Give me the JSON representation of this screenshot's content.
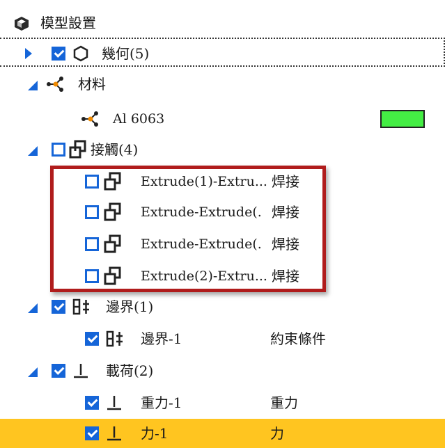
{
  "header": {
    "title": "模型設置",
    "icon": "model-cube-icon"
  },
  "rows": {
    "geometry": {
      "label": "幾何(5)",
      "checked": true,
      "icon": "hexagon-icon"
    },
    "material": {
      "label": "材料",
      "icon": "material-icon"
    },
    "material_item": {
      "label": "Al 6063",
      "color": "#44ee44",
      "icon": "material-icon"
    },
    "contacts": {
      "label": "接觸(4)",
      "checked": false,
      "icon": "contact-icon"
    },
    "contact_1": {
      "label": "Extrude(1)-Extru...",
      "type": "焊接",
      "checked": false
    },
    "contact_2": {
      "label": "Extrude-Extrude(.",
      "type": "焊接",
      "checked": false
    },
    "contact_3": {
      "label": "Extrude-Extrude(.",
      "type": "焊接",
      "checked": false
    },
    "contact_4": {
      "label": "Extrude(2)-Extru...",
      "type": "焊接",
      "checked": false
    },
    "boundary": {
      "label": "邊界(1)",
      "checked": true,
      "icon": "boundary-icon"
    },
    "boundary_1": {
      "label": "邊界-1",
      "type": "約束條件",
      "checked": true
    },
    "loads": {
      "label": "載荷(2)",
      "checked": true,
      "icon": "load-icon"
    },
    "load_1": {
      "label": "重力-1",
      "type": "重力",
      "checked": true
    },
    "load_2": {
      "label": "力-1",
      "type": "力",
      "checked": true,
      "selected": true
    }
  },
  "colors": {
    "accent": "#1565d8",
    "selection": "#ffc520",
    "highlight": "#b01c1c"
  }
}
